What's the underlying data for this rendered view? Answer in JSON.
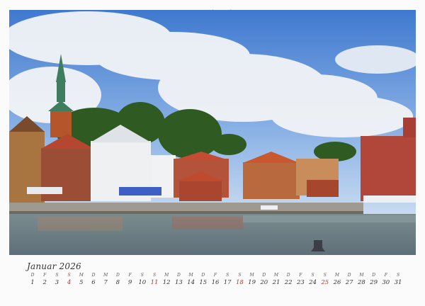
{
  "calendar": {
    "month_label": "Januar 2026",
    "days": [
      {
        "name": "D",
        "num": "1"
      },
      {
        "name": "F",
        "num": "2"
      },
      {
        "name": "S",
        "num": "3"
      },
      {
        "name": "S",
        "num": "4",
        "sunday": true
      },
      {
        "name": "M",
        "num": "5"
      },
      {
        "name": "D",
        "num": "6"
      },
      {
        "name": "M",
        "num": "7"
      },
      {
        "name": "D",
        "num": "8"
      },
      {
        "name": "F",
        "num": "9"
      },
      {
        "name": "S",
        "num": "10"
      },
      {
        "name": "S",
        "num": "11",
        "sunday": true
      },
      {
        "name": "M",
        "num": "12"
      },
      {
        "name": "D",
        "num": "13"
      },
      {
        "name": "M",
        "num": "14"
      },
      {
        "name": "D",
        "num": "15"
      },
      {
        "name": "F",
        "num": "16"
      },
      {
        "name": "S",
        "num": "17"
      },
      {
        "name": "S",
        "num": "18",
        "sunday": true
      },
      {
        "name": "M",
        "num": "19"
      },
      {
        "name": "D",
        "num": "20"
      },
      {
        "name": "M",
        "num": "21"
      },
      {
        "name": "D",
        "num": "22"
      },
      {
        "name": "F",
        "num": "23"
      },
      {
        "name": "S",
        "num": "24"
      },
      {
        "name": "S",
        "num": "25",
        "sunday": true
      },
      {
        "name": "M",
        "num": "26"
      },
      {
        "name": "D",
        "num": "27"
      },
      {
        "name": "M",
        "num": "28"
      },
      {
        "name": "D",
        "num": "29"
      },
      {
        "name": "F",
        "num": "30"
      },
      {
        "name": "S",
        "num": "31"
      }
    ]
  },
  "colors": {
    "sunday": "#c0322e",
    "text": "#333333",
    "sky": "#5c8fd6",
    "water": "#6d7f86"
  }
}
